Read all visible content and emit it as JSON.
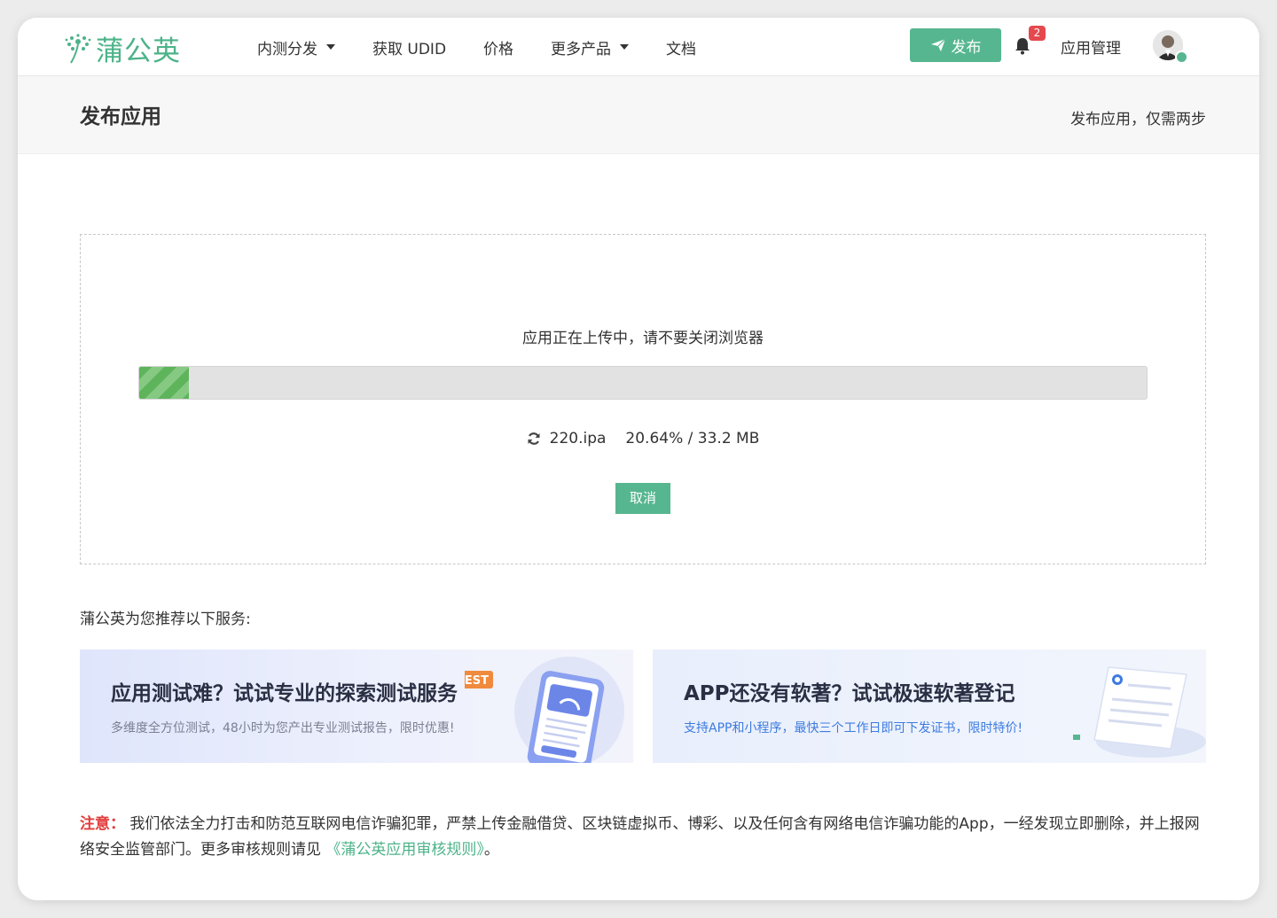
{
  "header": {
    "logo_text": "蒲公英",
    "nav": [
      {
        "label": "内测分发",
        "dropdown": true
      },
      {
        "label": "获取 UDID",
        "dropdown": false
      },
      {
        "label": "价格",
        "dropdown": false
      },
      {
        "label": "更多产品",
        "dropdown": true
      },
      {
        "label": "文档",
        "dropdown": false
      }
    ],
    "publish_label": "发布",
    "notification_count": "2",
    "app_manage_label": "应用管理",
    "accent_color": "#56b690"
  },
  "page": {
    "title": "发布应用",
    "subtitle": "发布应用，仅需两步"
  },
  "upload": {
    "message": "应用正在上传中，请不要关闭浏览器",
    "progress_percent": 20.64,
    "file_name": "220.ipa",
    "progress_text": "20.64% / 33.2 MB",
    "cancel_label": "取消"
  },
  "recommend": {
    "title": "蒲公英为您推荐以下服务:",
    "cards": [
      {
        "heading": "应用测试难？试试专业的探索测试服务",
        "desc": "多维度全方位测试，48小时为您产出专业测试报告，限时优惠!",
        "art_tag": "TEST"
      },
      {
        "heading": "APP还没有软著？试试极速软著登记",
        "desc": "支持APP和小程序，最快三个工作日即可下发证书，限时特价!"
      }
    ]
  },
  "notice": {
    "label": "注意：",
    "text": "我们依法全力打击和防范互联网电信诈骗犯罪，严禁上传金融借贷、区块链虚拟币、博彩、以及任何含有网络电信诈骗功能的App，一经发现立即删除，并上报网络安全监管部门。更多审核规则请见",
    "link_text": "《蒲公英应用审核规则》",
    "end": "。"
  }
}
